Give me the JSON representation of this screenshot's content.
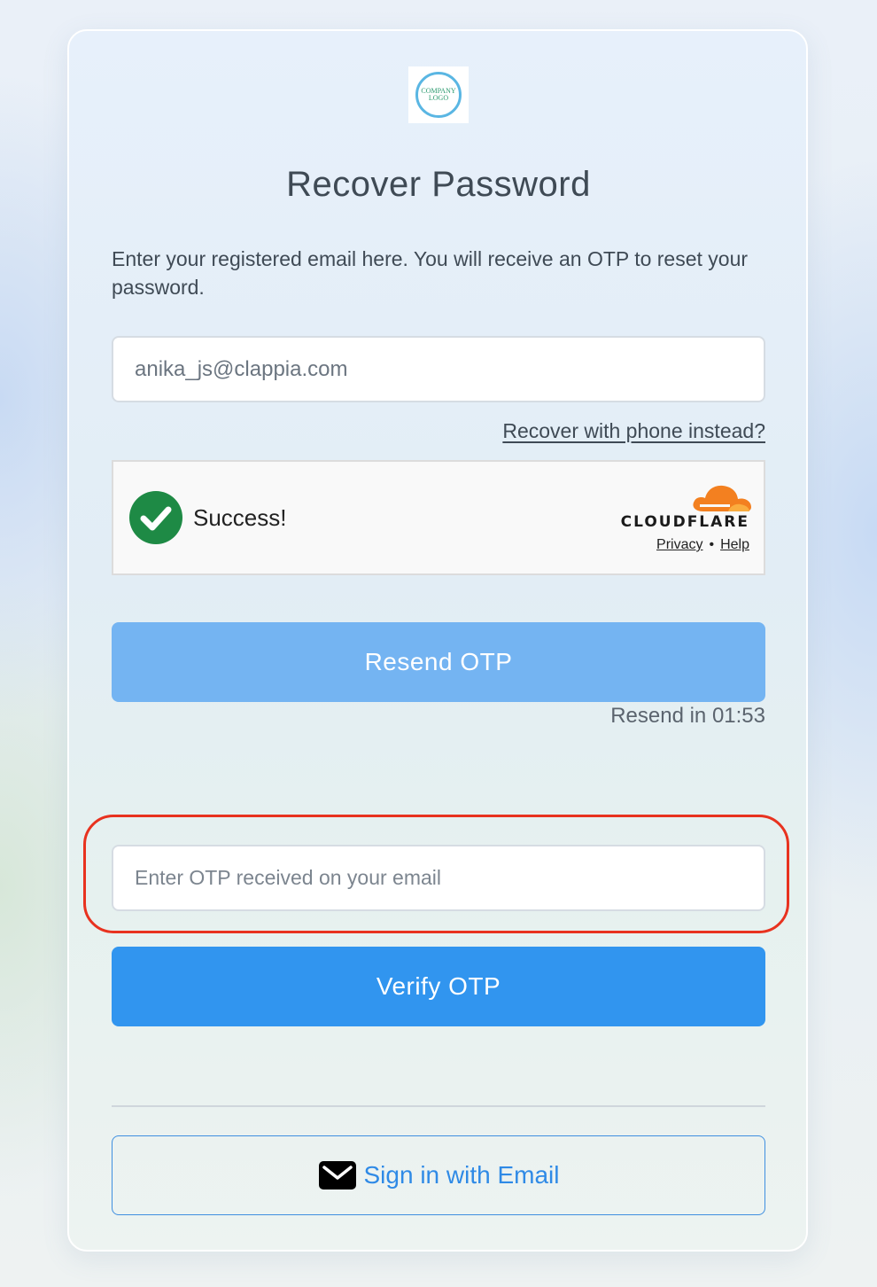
{
  "logo": {
    "line1": "COMPANY",
    "line2": "LOGO"
  },
  "title": "Recover Password",
  "description": "Enter your registered email here. You will receive an OTP to reset your password.",
  "email_input": {
    "value": "anika_js@clappia.com"
  },
  "phone_link": "Recover with phone instead?",
  "captcha": {
    "status": "Success!",
    "brand": "CLOUDFLARE",
    "privacy": "Privacy",
    "separator": "•",
    "help": "Help"
  },
  "resend_button": "Resend OTP",
  "resend_timer": "Resend in 01:53",
  "otp_input": {
    "placeholder": "Enter OTP received on your email",
    "value": ""
  },
  "verify_button": "Verify OTP",
  "email_signin_button": "Sign in with Email",
  "colors": {
    "resend_button": "#74b4f2",
    "verify_button": "#3195ef",
    "success_green": "#1e8a45",
    "cloudflare_orange": "#f38020",
    "highlight": "#e8321f"
  }
}
